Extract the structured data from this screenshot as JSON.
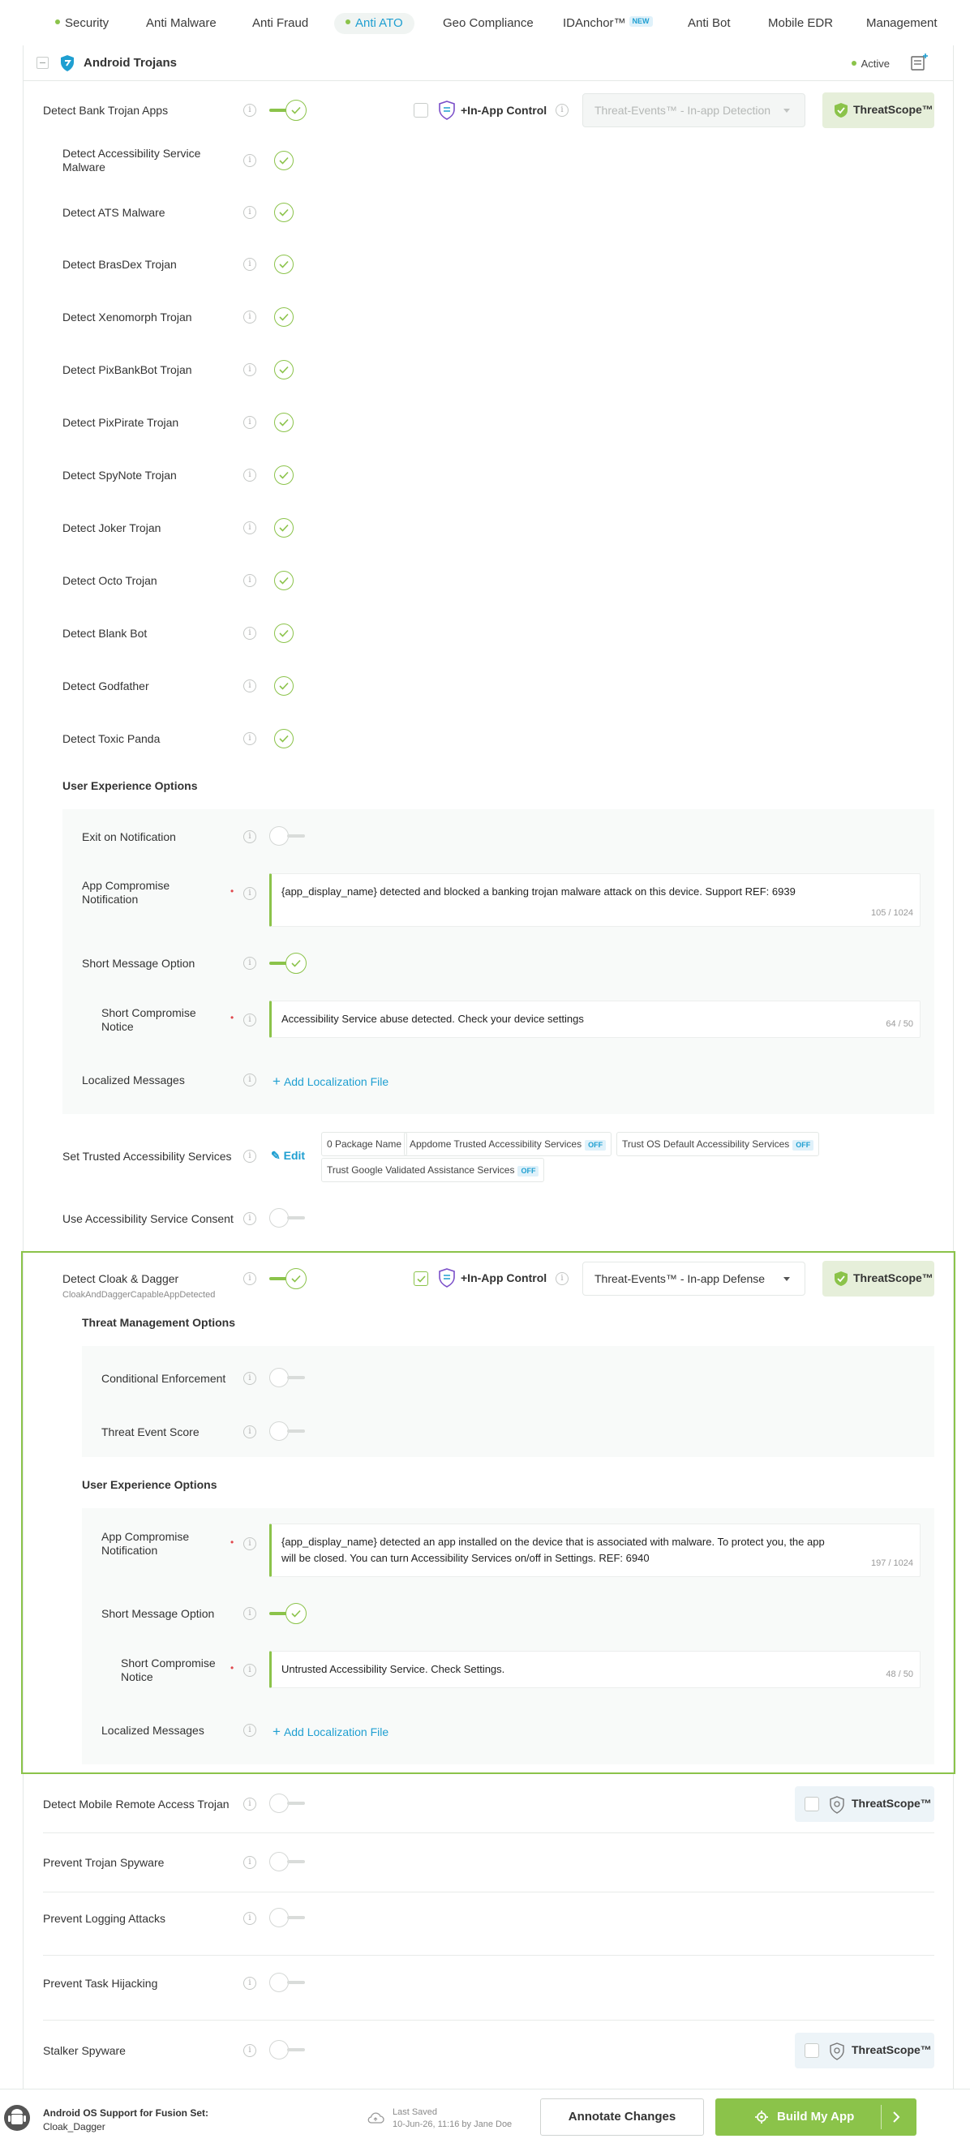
{
  "tabs": [
    {
      "label": "Security",
      "dot": true
    },
    {
      "label": "Anti Malware"
    },
    {
      "label": "Anti Fraud"
    },
    {
      "label": "Anti ATO",
      "dot": true,
      "active": true
    },
    {
      "label": "Geo Compliance"
    },
    {
      "label": "IDAnchor™",
      "badge": "NEW"
    },
    {
      "label": "Anti Bot"
    },
    {
      "label": "Mobile EDR"
    },
    {
      "label": "Management"
    }
  ],
  "card": {
    "title": "Android Trojans",
    "status": "Active"
  },
  "bank": {
    "label": "Detect Bank Trojan Apps",
    "inapp_label": "+In-App Control",
    "select_value": "Threat-Events™ - In-app Detection",
    "threatscope": "ThreatScope™",
    "children": [
      "Detect Accessibility Service Malware",
      "Detect ATS Malware",
      "Detect BrasDex Trojan",
      "Detect Xenomorph Trojan",
      "Detect PixBankBot Trojan",
      "Detect PixPirate Trojan",
      "Detect SpyNote Trojan",
      "Detect Joker Trojan",
      "Detect Octo Trojan",
      "Detect Blank Bot",
      "Detect Godfather",
      "Detect Toxic Panda"
    ],
    "ux_title": "User Experience Options",
    "exit_label": "Exit on Notification",
    "notif_label": "App Compromise Notification",
    "notif_value": "{app_display_name} detected and blocked a banking trojan malware attack on this device. Support REF: 6939",
    "notif_count": "105 / 1024",
    "short_opt_label": "Short Message Option",
    "short_notice_label": "Short Compromise Notice",
    "short_notice_value": "Accessibility Service abuse detected. Check your device settings",
    "short_notice_count": "64 / 50",
    "localized_label": "Localized Messages",
    "add_loc": "Add Localization File"
  },
  "trusted": {
    "label": "Set Trusted Accessibility Services",
    "edit": "Edit",
    "chips": [
      "0 Package Name",
      "Appdome Trusted Accessibility Services",
      "Trust OS Default Accessibility Services",
      "Trust Google Validated Assistance Services"
    ],
    "off": "OFF"
  },
  "consent": {
    "label": "Use Accessibility Service Consent"
  },
  "cloak": {
    "label": "Detect Cloak & Dagger",
    "code": "CloakAndDaggerCapableAppDetected",
    "inapp_label": "+In-App Control",
    "select_value": "Threat-Events™ - In-app Defense",
    "threatscope": "ThreatScope™",
    "tm_title": "Threat Management Options",
    "cond_label": "Conditional Enforcement",
    "score_label": "Threat Event Score",
    "ux_title": "User Experience Options",
    "notif_label": "App Compromise Notification",
    "notif_value": "{app_display_name} detected an app installed on the device that is associated with malware. To protect you, the app will be closed. You can turn Accessibility Services on/off in Settings. REF: 6940",
    "notif_count": "197 / 1024",
    "short_opt_label": "Short Message Option",
    "short_notice_label": "Short Compromise Notice",
    "short_notice_value": "Untrusted Accessibility Service. Check Settings.",
    "short_notice_count": "48 / 50",
    "localized_label": "Localized Messages",
    "add_loc": "Add Localization File"
  },
  "bottom_rows": [
    {
      "label": "Detect Mobile Remote Access Trojan",
      "threatscope": "ThreatScope™"
    },
    {
      "label": "Prevent Trojan Spyware"
    },
    {
      "label": "Prevent Logging Attacks"
    },
    {
      "label": "Prevent Task Hijacking"
    },
    {
      "label": "Stalker Spyware",
      "threatscope": "ThreatScope™"
    }
  ],
  "footer": {
    "title": "Android OS Support for Fusion Set:",
    "fusion_set": "Cloak_Dagger",
    "saved_label": "Last Saved",
    "saved_value": "10-Jun-26, 11:16 by Jane Doe",
    "annotate": "Annotate Changes",
    "build": "Build My App"
  },
  "colors": {
    "accent_green": "#8bc34a",
    "link_blue": "#1f9fd1",
    "required_red": "#e0474c"
  },
  "icons": [
    "shield-icon",
    "document-add-icon",
    "info-icon",
    "check-icon",
    "inapp-shield-icon",
    "threatscope-shield-icon",
    "pencil-icon",
    "plus-icon",
    "cloud-icon",
    "android-icon",
    "gear-icon",
    "chevron-right-icon"
  ]
}
